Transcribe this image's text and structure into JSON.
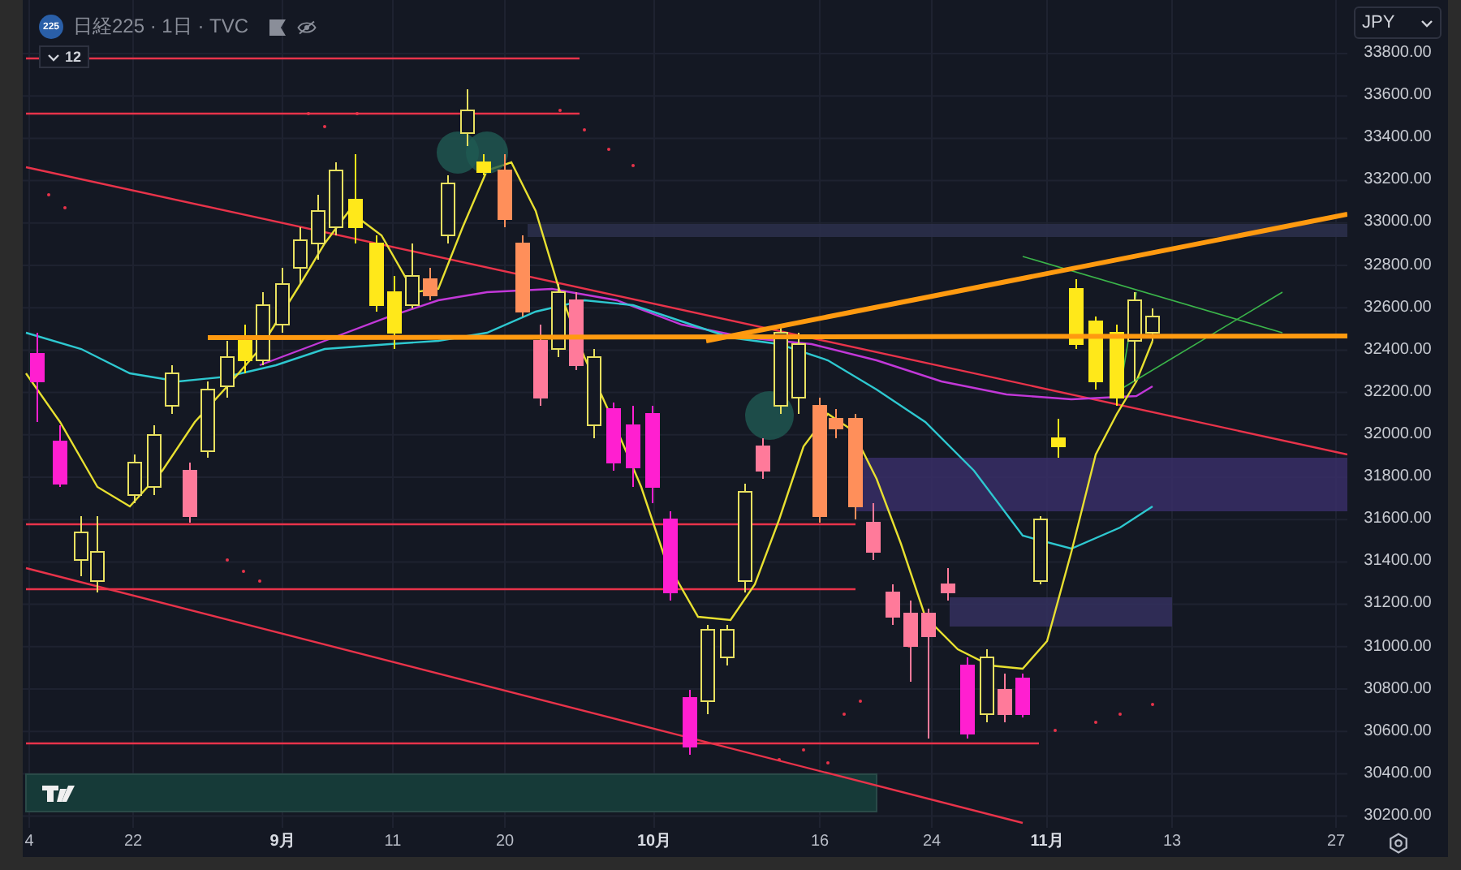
{
  "header": {
    "symbol_badge": "225",
    "title": "日経225 · 1日 · TVC"
  },
  "indicators": {
    "count": "12"
  },
  "currency": "JPY",
  "price_axis": {
    "labels": [
      "33800.00",
      "33600.00",
      "33400.00",
      "33200.00",
      "33000.00",
      "32800.00",
      "32600.00",
      "32400.00",
      "32200.00",
      "32000.00",
      "31800.00",
      "31600.00",
      "31400.00",
      "31200.00",
      "31000.00",
      "30800.00",
      "30600.00",
      "30400.00",
      "30200.00"
    ]
  },
  "time_axis": {
    "labels": [
      {
        "text": "4",
        "kind": "day"
      },
      {
        "text": "22",
        "kind": "day"
      },
      {
        "text": "9月",
        "kind": "month"
      },
      {
        "text": "11",
        "kind": "day"
      },
      {
        "text": "20",
        "kind": "day"
      },
      {
        "text": "10月",
        "kind": "month"
      },
      {
        "text": "16",
        "kind": "day"
      },
      {
        "text": "24",
        "kind": "day"
      },
      {
        "text": "11月",
        "kind": "month"
      },
      {
        "text": "13",
        "kind": "day"
      },
      {
        "text": "27",
        "kind": "day"
      }
    ]
  }
}
